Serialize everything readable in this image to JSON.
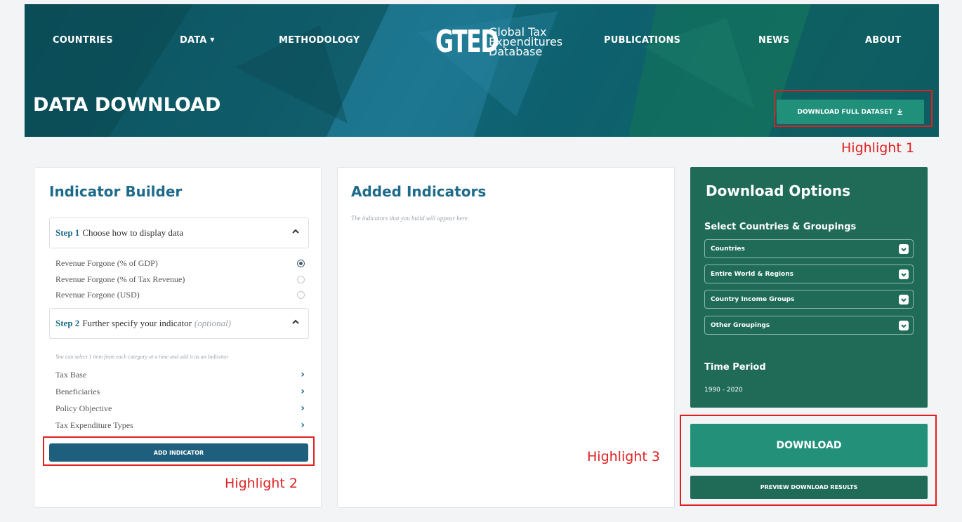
{
  "nav": {
    "countries": "COUNTRIES",
    "data": "DATA",
    "methodology": "METHODOLOGY",
    "publications": "PUBLICATIONS",
    "news": "NEWS",
    "about": "ABOUT"
  },
  "logo": {
    "mark": "GTED",
    "line1": "Global Tax",
    "line2": "Expenditures",
    "line3": "Database"
  },
  "header": {
    "title": "DATA DOWNLOAD",
    "download_full_label": "DOWNLOAD FULL DATASET",
    "download_full_icon": "download-icon"
  },
  "highlights": [
    "Highlight 1",
    "Highlight 2",
    "Highlight 3"
  ],
  "builder": {
    "title": "Indicator Builder",
    "step1": {
      "num": "Step 1",
      "text": "Choose how to display data"
    },
    "radios": [
      {
        "label": "Revenue Forgone (% of GDP)",
        "selected": true
      },
      {
        "label": "Revenue Forgone (% of Tax Revenue)",
        "selected": false
      },
      {
        "label": "Revenue Forgone (USD)",
        "selected": false
      }
    ],
    "step2": {
      "num": "Step 2",
      "text": "Further specify your indicator",
      "optional": "(optional)"
    },
    "hint": "You can select 1 item from each category at a time and add it as an Indicator",
    "categories": [
      "Tax Base",
      "Beneficiaries",
      "Policy Objective",
      "Tax Expenditure Types"
    ],
    "add_label": "ADD INDICATOR"
  },
  "added": {
    "title": "Added Indicators",
    "hint": "The indicators that you build will appear here."
  },
  "options": {
    "title": "Download Options",
    "countries_heading": "Select Countries & Groupings",
    "selects": [
      "Countries",
      "Entire World & Regions",
      "Country Income Groups",
      "Other Groupings"
    ],
    "time_heading": "Time Period",
    "period": "1990 - 2020",
    "accent": "#1f6b58"
  },
  "actions": {
    "download_label": "DOWNLOAD",
    "preview_label": "PREVIEW DOWNLOAD RESULTS"
  }
}
